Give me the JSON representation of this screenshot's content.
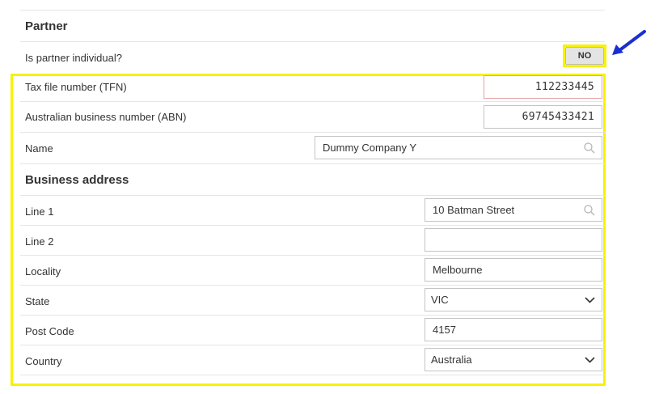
{
  "partner": {
    "section_title": "Partner",
    "is_individual_label": "Is partner individual?",
    "is_individual_value": "NO",
    "tfn_label": "Tax file number (TFN)",
    "tfn_value": "112233445",
    "abn_label": "Australian business number (ABN)",
    "abn_value": "69745433421",
    "name_label": "Name",
    "name_value": "Dummy Company Y"
  },
  "business_address": {
    "section_title": "Business address",
    "line1_label": "Line 1",
    "line1_value": "10 Batman Street",
    "line2_label": "Line 2",
    "line2_value": "",
    "locality_label": "Locality",
    "locality_value": "Melbourne",
    "state_label": "State",
    "state_value": "VIC",
    "postcode_label": "Post Code",
    "postcode_value": "4157",
    "country_label": "Country",
    "country_value": "Australia"
  },
  "colors": {
    "highlight": "#f6f200",
    "arrow": "#1a2fd0",
    "error_border": "#e8a0a4"
  },
  "icons": {
    "search": "search-icon",
    "dropdown": "chevron-down-icon",
    "annotation": "arrow-icon"
  }
}
